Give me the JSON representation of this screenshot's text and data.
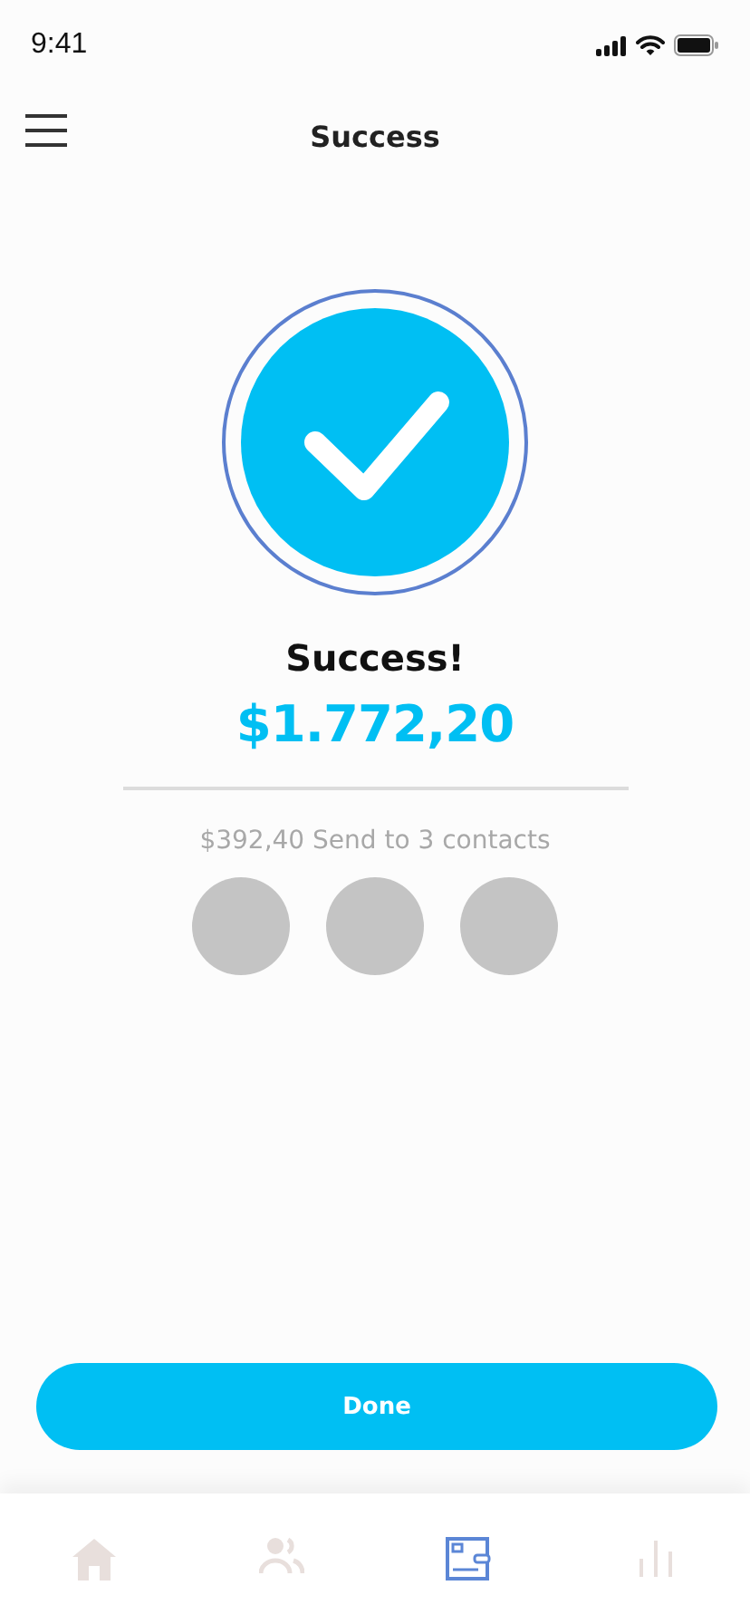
{
  "status_bar": {
    "time": "9:41"
  },
  "header": {
    "title": "Success"
  },
  "result": {
    "heading": "Success!",
    "amount": "$1.772,20",
    "summary": "$392,40 Send to 3 contacts"
  },
  "contacts": [
    {
      "kind": "avatar"
    },
    {
      "kind": "avatar"
    },
    {
      "kind": "avatar"
    }
  ],
  "done_button": {
    "label": "Done"
  },
  "tab_bar": [
    {
      "kind": "home",
      "selected": false
    },
    {
      "kind": "people",
      "selected": false
    },
    {
      "kind": "wallet",
      "selected": true
    },
    {
      "kind": "stats",
      "selected": false
    }
  ]
}
